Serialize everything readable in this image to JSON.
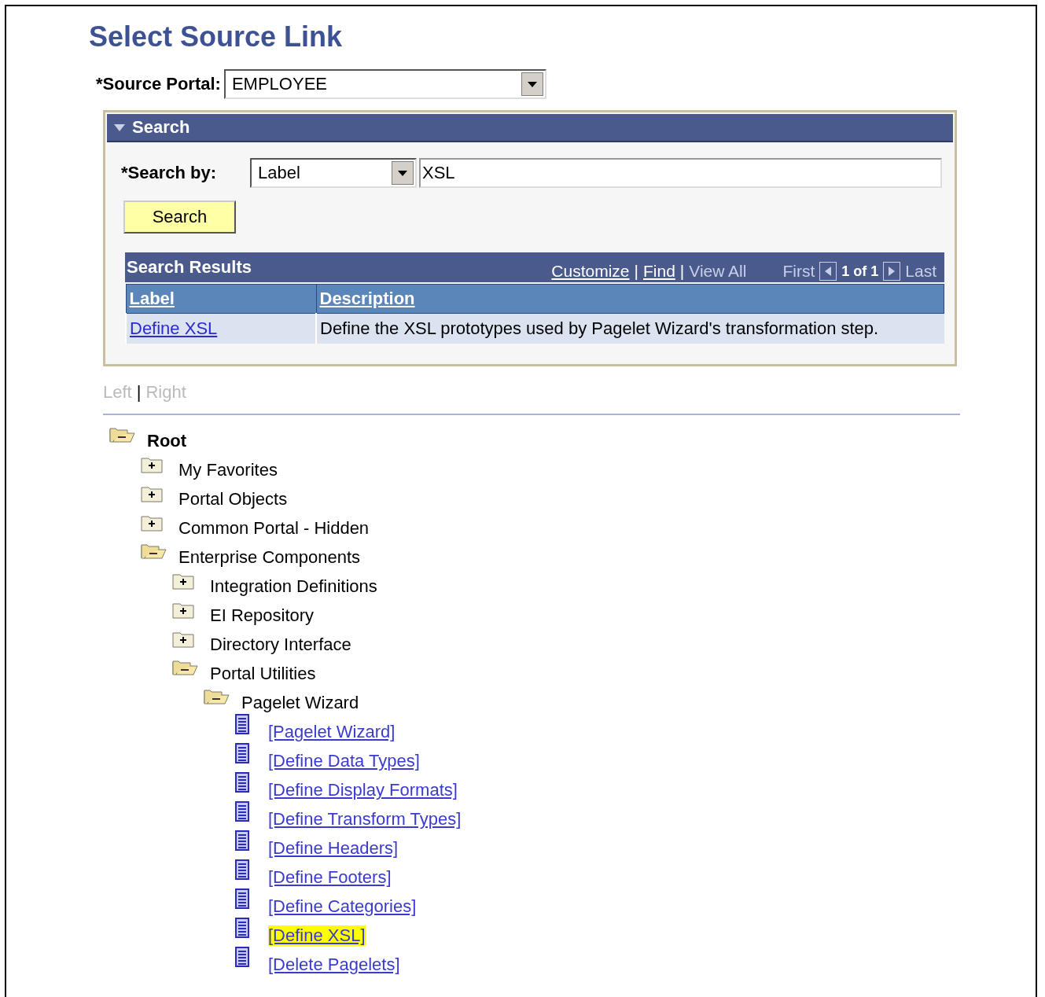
{
  "title": "Select Source Link",
  "source_portal": {
    "label": "*Source Portal:",
    "value": "EMPLOYEE"
  },
  "search_panel": {
    "title": "Search",
    "expanded": true,
    "search_by": {
      "label": "*Search by:",
      "field": "Label",
      "value": "XSL"
    },
    "button": "Search",
    "results": {
      "title": "Search Results",
      "separator": "|",
      "links": [
        {
          "label": "Customize",
          "disabled": false
        },
        {
          "label": "Find",
          "disabled": false
        },
        {
          "label": "View All",
          "disabled": true
        }
      ],
      "pager": {
        "first": "First",
        "count": "1 of 1",
        "last": "Last"
      },
      "columns": [
        "Label",
        "Description"
      ],
      "rows": [
        {
          "label": "Define XSL",
          "description": "Define the XSL prototypes used by Pagelet Wizard's transformation step."
        }
      ]
    }
  },
  "view_links": {
    "separator": "|",
    "items": [
      {
        "label": "Left",
        "disabled": true
      },
      {
        "label": "Right",
        "disabled": true
      }
    ]
  },
  "tree": [
    {
      "kind": "folder",
      "label": "Root",
      "expanded": true,
      "children": [
        {
          "kind": "folder",
          "label": "My Favorites",
          "expanded": false
        },
        {
          "kind": "folder",
          "label": "Portal Objects",
          "expanded": false
        },
        {
          "kind": "folder",
          "label": "Common Portal - Hidden",
          "expanded": false
        },
        {
          "kind": "folder",
          "label": "Enterprise Components",
          "expanded": true,
          "children": [
            {
              "kind": "folder",
              "label": "Integration Definitions",
              "expanded": false
            },
            {
              "kind": "folder",
              "label": "EI Repository",
              "expanded": false
            },
            {
              "kind": "folder",
              "label": "Directory Interface",
              "expanded": false
            },
            {
              "kind": "folder",
              "label": "Portal Utilities",
              "expanded": true,
              "children": [
                {
                  "kind": "folder",
                  "label": "Pagelet Wizard",
                  "expanded": true,
                  "children": [
                    {
                      "kind": "link",
                      "label": "[Pagelet Wizard]",
                      "highlighted": false
                    },
                    {
                      "kind": "link",
                      "label": "[Define Data Types]",
                      "highlighted": false
                    },
                    {
                      "kind": "link",
                      "label": "[Define Display Formats]",
                      "highlighted": false
                    },
                    {
                      "kind": "link",
                      "label": "[Define Transform Types]",
                      "highlighted": false
                    },
                    {
                      "kind": "link",
                      "label": "[Define Headers]",
                      "highlighted": false
                    },
                    {
                      "kind": "link",
                      "label": "[Define Footers]",
                      "highlighted": false
                    },
                    {
                      "kind": "link",
                      "label": "[Define Categories]",
                      "highlighted": false
                    },
                    {
                      "kind": "link",
                      "label": "[Define XSL]",
                      "highlighted": true
                    },
                    {
                      "kind": "link",
                      "label": "[Delete Pagelets]",
                      "highlighted": false
                    }
                  ]
                }
              ]
            }
          ]
        }
      ]
    }
  ]
}
